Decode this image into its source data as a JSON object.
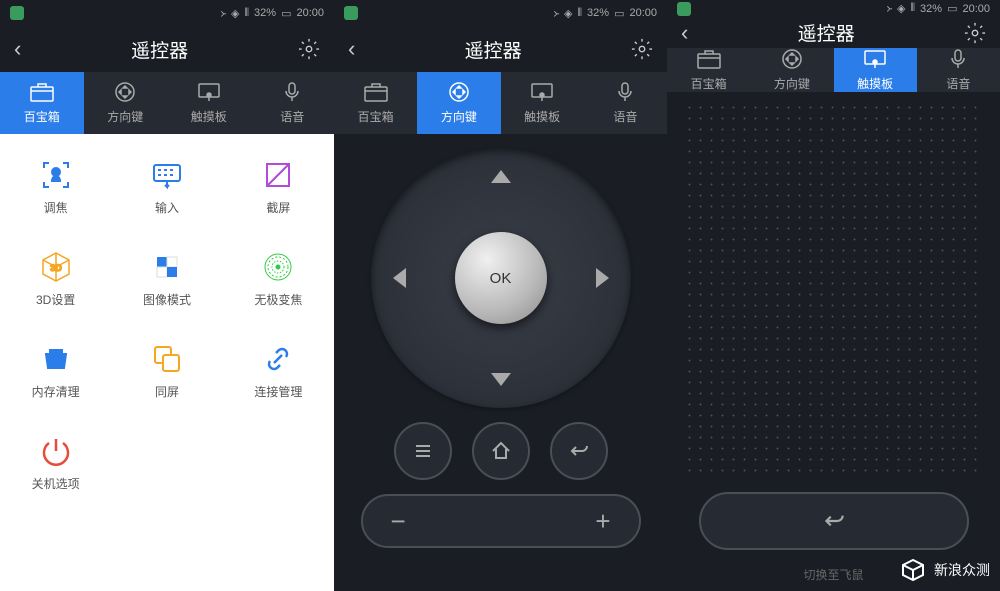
{
  "status": {
    "battery": "32%",
    "time": "20:00"
  },
  "header": {
    "title": "遥控器"
  },
  "tabs": {
    "box": "百宝箱",
    "dpad": "方向键",
    "touch": "触摸板",
    "voice": "语音"
  },
  "grid": {
    "focus": "调焦",
    "input": "输入",
    "screenshot": "截屏",
    "3d": "3D设置",
    "image_mode": "图像模式",
    "infinite_zoom": "无极变焦",
    "memory": "内存清理",
    "mirror": "同屏",
    "connection": "连接管理",
    "power": "关机选项"
  },
  "dpad": {
    "ok": "OK"
  },
  "touch": {
    "hint": "切换至飞鼠"
  },
  "watermark": "新浪众测"
}
